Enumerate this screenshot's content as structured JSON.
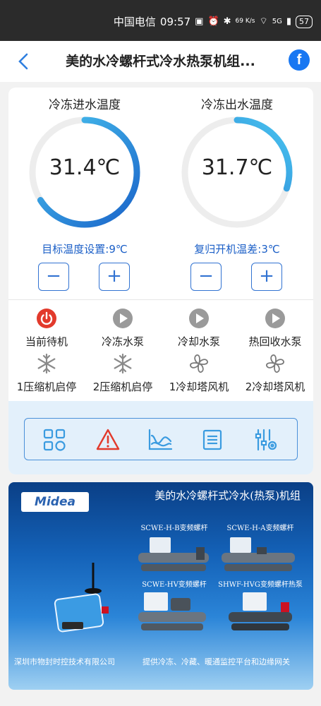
{
  "status_bar": {
    "carrier": "中国电信",
    "time": "09:57",
    "signal": "5G",
    "net_speed": "69 K/s",
    "battery": "57"
  },
  "header": {
    "title": "美的水冷螺杆式冷水热泵机组...",
    "share_icon": "facebook-icon"
  },
  "gauges": [
    {
      "label": "冷冻进水温度",
      "value": "31.4℃",
      "setting": "目标温度设置:9℃",
      "arc_fraction": 0.66
    },
    {
      "label": "冷冻出水温度",
      "value": "31.7℃",
      "setting": "复归开机温差:3℃",
      "arc_fraction": 0.3
    }
  ],
  "controls": {
    "minus": "−",
    "plus": "+"
  },
  "status_items": [
    {
      "label": "当前待机",
      "icon": "power-icon"
    },
    {
      "label": "冷冻水泵",
      "icon": "play-icon"
    },
    {
      "label": "冷却水泵",
      "icon": "play-icon"
    },
    {
      "label": "热回收水泵",
      "icon": "play-icon"
    },
    {
      "label": "1压缩机启停",
      "icon": "snowflake-icon"
    },
    {
      "label": "2压缩机启停",
      "icon": "snowflake-icon"
    },
    {
      "label": "1冷却塔风机",
      "icon": "fan-icon"
    },
    {
      "label": "2冷却塔风机",
      "icon": "fan-icon"
    }
  ],
  "toolbar": [
    "grid-icon",
    "alarm-icon",
    "chart-icon",
    "list-icon",
    "settings-sliders-icon"
  ],
  "banner": {
    "logo": "Midea",
    "title": "美的水冷螺杆式冷水(热泵)机组",
    "products": [
      "SCWE-H-B变频螺杆",
      "SCWE-H-A变频螺杆",
      "SCWE-HV变频螺杆",
      "SHWF-HVG变频螺杆热泵"
    ],
    "footer_left": "深圳市物封时控技术有限公司",
    "footer_right": "提供冷冻、冷藏、暖通监控平台和边缘网关"
  },
  "colors": {
    "accent": "#3273d2",
    "gauge_start": "#1a63c9",
    "gauge_end": "#4ac6f0",
    "power_red": "#e23a2c"
  }
}
